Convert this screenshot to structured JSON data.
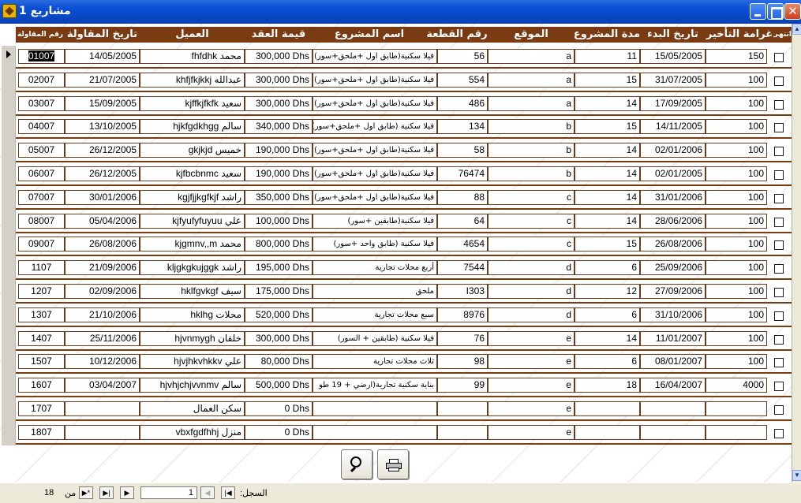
{
  "window": {
    "title": "مشاريع 1",
    "close_glyph": "✕"
  },
  "columns": [
    {
      "label": "انتهى"
    },
    {
      "label": "غرامة التأخير"
    },
    {
      "label": "تاريخ البدء"
    },
    {
      "label": "مدة المشروع"
    },
    {
      "label": "الموقع"
    },
    {
      "label": "رقم القطعة"
    },
    {
      "label": "اسم المشروع"
    },
    {
      "label": "قيمة العقد"
    },
    {
      "label": "العميل"
    },
    {
      "label": "تاريخ المقاولة"
    },
    {
      "label": "رقم المقاولة"
    }
  ],
  "rows": [
    {
      "contract_no": "01007",
      "contract_date": "14/05/2005",
      "client": "fhfdhk محمد",
      "value": "300,000 Dhs",
      "project": "فيلا سكنية(طابق اول +ملحق+سور)",
      "plot": "56",
      "location": "a",
      "duration": "11",
      "start_date": "15/05/2005",
      "penalty": "150"
    },
    {
      "contract_no": "02007",
      "contract_date": "21/07/2005",
      "client": "khfjfkjkkj عبدالله",
      "value": "300,000 Dhs",
      "project": "فيلا سكنية(طابق اول +ملحق+سور)",
      "plot": "554",
      "location": "a",
      "duration": "15",
      "start_date": "31/07/2005",
      "penalty": "100"
    },
    {
      "contract_no": "03007",
      "contract_date": "15/09/2005",
      "client": "kjffkjfkfk سعيد",
      "value": "300,000 Dhs",
      "project": "فيلا سكنية(طابق اول +ملحق+سور)",
      "plot": "486",
      "location": "a",
      "duration": "14",
      "start_date": "17/09/2005",
      "penalty": "100"
    },
    {
      "contract_no": "04007",
      "contract_date": "13/10/2005",
      "client": "hjkfgdkhgg سالم",
      "value": "340,000 Dhs",
      "project": "فيلا سكنية (طابق اول +ملحق+سور)",
      "plot": "134",
      "location": "b",
      "duration": "15",
      "start_date": "14/11/2005",
      "penalty": "100"
    },
    {
      "contract_no": "05007",
      "contract_date": "26/12/2005",
      "client": "gkjkjd خميس",
      "value": "190,000 Dhs",
      "project": "فيلا سكنية(طابق اول +ملحق+سور)",
      "plot": "58",
      "location": "b",
      "duration": "14",
      "start_date": "02/01/2006",
      "penalty": "100"
    },
    {
      "contract_no": "06007",
      "contract_date": "26/12/2005",
      "client": "kjfbcbnmc سعيد",
      "value": "190,000 Dhs",
      "project": "فيلا سكنية(طابق اول +ملحق+سور)",
      "plot": "76474",
      "location": "b",
      "duration": "14",
      "start_date": "02/01/2005",
      "penalty": "100"
    },
    {
      "contract_no": "07007",
      "contract_date": "30/01/2006",
      "client": "kgjfjjkgfkjf راشد",
      "value": "350,000 Dhs",
      "project": "فيلا سكنية(طابق اول +ملحق+سور)",
      "plot": "88",
      "location": "c",
      "duration": "14",
      "start_date": "31/01/2006",
      "penalty": "100"
    },
    {
      "contract_no": "08007",
      "contract_date": "05/04/2006",
      "client": "kjfyufyfuyuu علي",
      "value": "100,000 Dhs",
      "project": "فيلا سكنية(طابقين +سور)",
      "plot": "64",
      "location": "c",
      "duration": "14",
      "start_date": "28/06/2006",
      "penalty": "100"
    },
    {
      "contract_no": "09007",
      "contract_date": "26/08/2006",
      "client": "kjgmnv,,m محمد",
      "value": "800,000 Dhs",
      "project": "فيلا سكنية (طابق واحد +سور)",
      "plot": "4654",
      "location": "c",
      "duration": "15",
      "start_date": "26/08/2006",
      "penalty": "100"
    },
    {
      "contract_no": "1107",
      "contract_date": "21/09/2006",
      "client": "kljgkgkujggk راشد",
      "value": "195,000 Dhs",
      "project": "أربع محلات تجارية",
      "plot": "7544",
      "location": "d",
      "duration": "6",
      "start_date": "25/09/2006",
      "penalty": "100"
    },
    {
      "contract_no": "1207",
      "contract_date": "02/09/2006",
      "client": "hklfgvkgf سيف",
      "value": "175,000 Dhs",
      "project": "ملحق",
      "plot": "I303",
      "location": "d",
      "duration": "12",
      "start_date": "27/09/2006",
      "penalty": "100"
    },
    {
      "contract_no": "1307",
      "contract_date": "21/10/2006",
      "client": "hklhg محلات",
      "value": "520,000 Dhs",
      "project": "سبع محلات تجارية",
      "plot": "8976",
      "location": "d",
      "duration": "6",
      "start_date": "31/10/2006",
      "penalty": "100"
    },
    {
      "contract_no": "1407",
      "contract_date": "25/11/2006",
      "client": "hjvnmygh خلفان",
      "value": "300,000 Dhs",
      "project": "فيلا سكنية (طابقين + السور)",
      "plot": "76",
      "location": "e",
      "duration": "14",
      "start_date": "11/01/2007",
      "penalty": "100"
    },
    {
      "contract_no": "1507",
      "contract_date": "10/12/2006",
      "client": "hjvjhkvhkkv علي",
      "value": "80,000 Dhs",
      "project": "ثلاث محلات تجارية",
      "plot": "98",
      "location": "e",
      "duration": "6",
      "start_date": "08/01/2007",
      "penalty": "100"
    },
    {
      "contract_no": "1607",
      "contract_date": "03/04/2007",
      "client": "hjvhjchjvvnmv سالم",
      "value": "500,000 Dhs",
      "project": "بناية سكنية تجارية(ارضي + 19 طو",
      "plot": "99",
      "location": "e",
      "duration": "18",
      "start_date": "16/04/2007",
      "penalty": "4000"
    },
    {
      "contract_no": "1707",
      "contract_date": "",
      "client": "سكن العمال",
      "value": "0 Dhs",
      "project": "",
      "plot": "",
      "location": "e",
      "duration": "",
      "start_date": "",
      "penalty": ""
    },
    {
      "contract_no": "1807",
      "contract_date": "",
      "client": "vbxfgdfhhj منزل",
      "value": "0 Dhs",
      "project": "",
      "plot": "",
      "location": "e",
      "duration": "",
      "start_date": "",
      "penalty": ""
    }
  ],
  "navigation": {
    "record_label": "السجل:",
    "current": "1",
    "of_label": "من",
    "total": "18",
    "first": "|◀",
    "prev": "◀",
    "next": "▶",
    "last": "▶|",
    "new": "▶*"
  }
}
